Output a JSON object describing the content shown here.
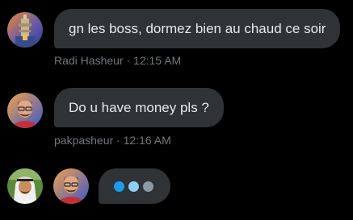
{
  "messages": [
    {
      "text": "gn les boss, dormez bien au chaud ce soir",
      "meta": "Radi Hasheur · 12:15 AM",
      "avatar_icon": "castle-tower-avatar-icon"
    },
    {
      "text": "Do u have money pls ?",
      "meta": "pakpasheur · 12:16 AM",
      "avatar_icon": "man-glasses-avatar-icon"
    }
  ],
  "typing": {
    "avatars": [
      "keffiyeh-man-avatar-icon",
      "man-glasses-avatar-icon"
    ],
    "dot_colors": [
      "#1d9bf0",
      "#8ecdf8",
      "#8b98a5"
    ]
  },
  "colors": {
    "background": "#000000",
    "bubble": "#2f3336",
    "text": "#e7e9ea",
    "meta": "#71767b"
  }
}
